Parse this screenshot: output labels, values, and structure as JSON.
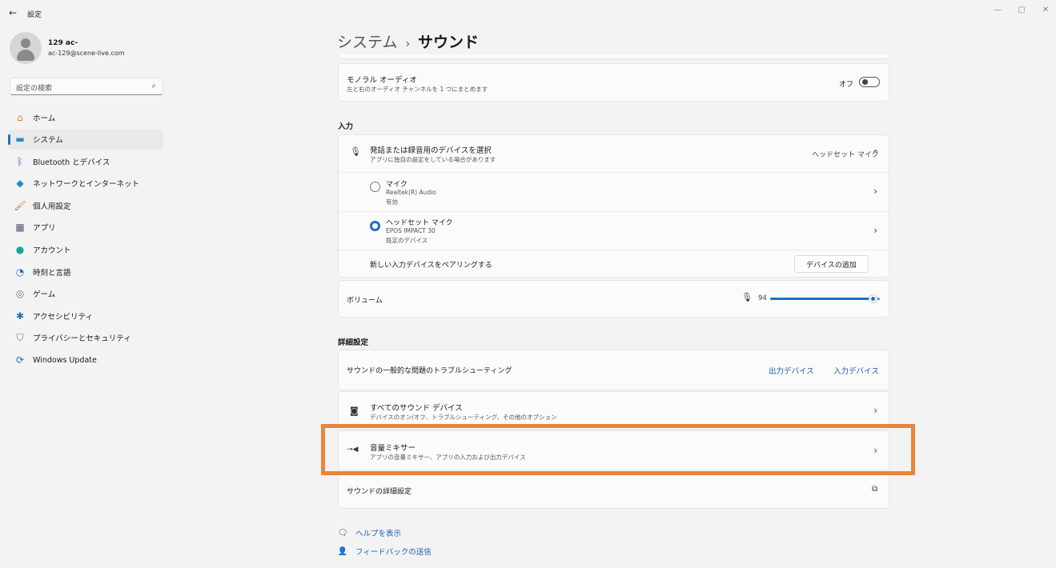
{
  "window": {
    "title": "設定",
    "back": "←",
    "controls": {
      "minimize": "—",
      "maximize": "▢",
      "close": "✕"
    }
  },
  "profile": {
    "name": "129 ac-",
    "email": "ac-129@scene-live.com"
  },
  "search": {
    "placeholder": "設定の検索",
    "icon": "search-icon",
    "glyph": "⌕"
  },
  "sidebar": {
    "items": [
      {
        "label": "ホーム",
        "icon": "home-icon",
        "glyph": "⌂",
        "color": "#d9822b"
      },
      {
        "label": "システム",
        "icon": "system-icon",
        "glyph": "▬",
        "color": "#1f8ad2",
        "active": true
      },
      {
        "label": "Bluetooth とデバイス",
        "icon": "bluetooth-icon",
        "glyph": "ᛒ",
        "color": "#1f6fc1"
      },
      {
        "label": "ネットワークとインターネット",
        "icon": "network-icon",
        "glyph": "◆",
        "color": "#1f8ad2"
      },
      {
        "label": "個人用設定",
        "icon": "brush-icon",
        "glyph": "🖌",
        "color": "#c8752b"
      },
      {
        "label": "アプリ",
        "icon": "apps-icon",
        "glyph": "▦",
        "color": "#4d5a6a"
      },
      {
        "label": "アカウント",
        "icon": "account-icon",
        "glyph": "●",
        "color": "#21a0a0"
      },
      {
        "label": "時刻と言語",
        "icon": "time-language-icon",
        "glyph": "◔",
        "color": "#1f6fc1"
      },
      {
        "label": "ゲーム",
        "icon": "gaming-icon",
        "glyph": "◎",
        "color": "#6b7480"
      },
      {
        "label": "アクセシビリティ",
        "icon": "accessibility-icon",
        "glyph": "✱",
        "color": "#1f6fc1"
      },
      {
        "label": "プライバシーとセキュリティ",
        "icon": "shield-icon",
        "glyph": "⛉",
        "color": "#6b7480"
      },
      {
        "label": "Windows Update",
        "icon": "update-icon",
        "glyph": "⟳",
        "color": "#1f6fc1"
      }
    ]
  },
  "breadcrumb": {
    "parent": "システム",
    "separator": "›",
    "current": "サウンド"
  },
  "mono_audio": {
    "title": "モノラル オーディオ",
    "desc": "左と右のオーディオ チャンネルを 1 つにまとめます",
    "state_label": "オフ"
  },
  "input_section": {
    "title": "入力",
    "choose": {
      "title": "発話または録音用のデバイスを選択",
      "desc": "アプリに独自の設定をしている場合があります",
      "value": "ヘッドセット マイク",
      "icon": "microphone-icon",
      "glyph": "🎙",
      "expand": "⌃"
    },
    "devices": [
      {
        "name": "マイク",
        "line1": "Realtek(R) Audio",
        "line2": "有効",
        "selected": false
      },
      {
        "name": "ヘッドセット マイク",
        "line1": "EPOS IMPACT 30",
        "line2": "既定のデバイス",
        "selected": true
      }
    ],
    "pair": {
      "label": "新しい入力デバイスをペアリングする",
      "button": "デバイスの追加"
    }
  },
  "volume": {
    "label": "ボリューム",
    "value": "94",
    "level": 0.94,
    "glyph": "🎙"
  },
  "advanced": {
    "title": "詳細設定",
    "troubleshoot": {
      "label": "サウンドの一般的な問題のトラブルシューティング",
      "link1": "出力デバイス",
      "link2": "入力デバイス"
    },
    "all_devices": {
      "title": "すべてのサウンド デバイス",
      "desc": "デバイスのオン/オフ、トラブルシューティング、その他のオプション",
      "icon": "speaker-icon",
      "glyph": "◙"
    },
    "mixer": {
      "title": "音量ミキサー",
      "desc": "アプリの音量ミキサー、アプリの入力および出力デバイス",
      "icon": "mixer-icon",
      "glyph": "⊸◀"
    },
    "more": {
      "label": "サウンドの詳細設定",
      "icon": "external-link-icon",
      "glyph": "⧉"
    }
  },
  "chevron": "›",
  "footer": {
    "help": {
      "label": "ヘルプを表示",
      "icon": "help-icon",
      "glyph": "🗨"
    },
    "feedback": {
      "label": "フィードバックの送信",
      "icon": "feedback-icon",
      "glyph": "👤"
    }
  },
  "colors": {
    "accent": "#1f6fc1",
    "highlight": "#e8843b",
    "link": "#1a5fb4"
  }
}
